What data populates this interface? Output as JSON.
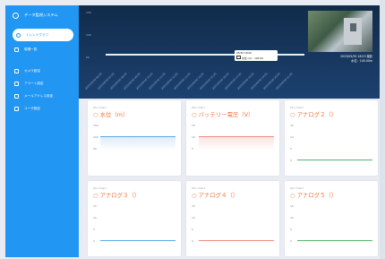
{
  "app": {
    "title": "データ監視システム"
  },
  "sidebar": {
    "items": [
      {
        "label": "トレンドグラフ",
        "active": true,
        "icon": "chart-icon"
      },
      {
        "label": "現場一覧",
        "active": false,
        "icon": "list-icon"
      },
      {
        "label": "カメラ設定",
        "active": false,
        "icon": "camera-icon"
      },
      {
        "label": "アラート設定",
        "active": false,
        "icon": "alert-icon"
      },
      {
        "label": "メールアドレス設定",
        "active": false,
        "icon": "mail-icon"
      },
      {
        "label": "ユーザ設定",
        "active": false,
        "icon": "user-icon"
      }
    ]
  },
  "hero": {
    "y_ticks": [
      "150",
      "100",
      "50"
    ],
    "x_labels": [
      "2023/05/30 06:00",
      "2023/05/30 07:00",
      "2023/05/30 08:00",
      "2023/05/30 09:00",
      "2023/05/30 10:00",
      "2023/05/30 11:00",
      "2023/05/30 12:00",
      "2023/05/30 13:00",
      "2023/05/30 14:00",
      "2023/05/30 15:00",
      "2023/05/30 16:00",
      "2023/05/30 17:00",
      "2023/05/30 18:00",
      "2023/05/30 19:00",
      "2023/05/30 20:00",
      "2023/05/30 21:00"
    ],
    "tooltip": {
      "line1": "05/30 18:00",
      "line2": "水位 (m) : 100.00"
    },
    "photo_caption1": "2023/05/30 18:53 撮影",
    "photo_caption2": "水位：100.00m",
    "trend_color": "#e6eef8"
  },
  "cards": [
    {
      "subtitle": "PLC Chart",
      "title": "水位（m）",
      "ticks": [
        "150",
        "100",
        "50"
      ],
      "line_color": "#5aa9e6",
      "band_color": "#dcebf8"
    },
    {
      "subtitle": "PLC Chart",
      "title": "バッテリー電圧（V）",
      "ticks": [
        "15",
        "10",
        "5"
      ],
      "line_color": "#f08a7c",
      "band_color": "#fbe3e0"
    },
    {
      "subtitle": "PLC Chart",
      "title": "アナログ２（）",
      "ticks": [
        "15",
        "10",
        "5",
        "0"
      ],
      "line_color": "#55b565",
      "band_color": ""
    },
    {
      "subtitle": "PLC Chart",
      "title": "アナログ３（）",
      "ticks": [
        "15",
        "10",
        "5",
        "0"
      ],
      "line_color": "#5aa9e6",
      "band_color": ""
    },
    {
      "subtitle": "PLC Chart",
      "title": "アナログ４（）",
      "ticks": [
        "15",
        "10",
        "5",
        "0"
      ],
      "line_color": "#f08a7c",
      "band_color": ""
    },
    {
      "subtitle": "PLC Chart",
      "title": "アナログ５（）",
      "ticks": [
        "15",
        "10",
        "5",
        "0"
      ],
      "line_color": "#55b565",
      "band_color": ""
    }
  ]
}
